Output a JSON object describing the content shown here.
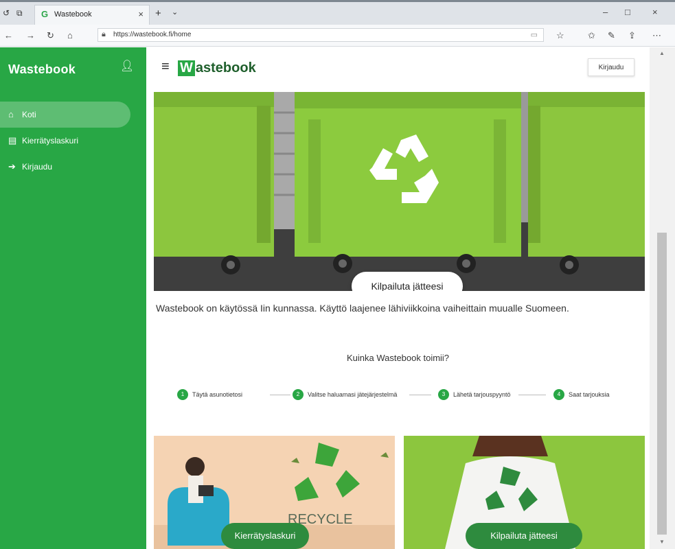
{
  "browser": {
    "tab_title": "Wastebook",
    "url": "https://wastebook.fi/home",
    "icons": [
      "back-icon",
      "forward-icon",
      "refresh-icon",
      "home-icon",
      "lock-icon",
      "reader-icon",
      "star-icon",
      "favorites-icon",
      "pen-icon",
      "share-icon",
      "more-icon"
    ]
  },
  "sidebar": {
    "logo": "Wastebook",
    "items": [
      {
        "label": "Koti",
        "icon": "home-icon"
      },
      {
        "label": "Kierrätyslaskuri",
        "icon": "calculator-icon"
      },
      {
        "label": "Kirjaudu",
        "icon": "login-icon"
      }
    ]
  },
  "header": {
    "logo_w": "W",
    "logo_rest": "astebook",
    "login_label": "Kirjaudu"
  },
  "hero": {
    "button_label": "Kilpailuta jätteesi"
  },
  "info_text": "Wastebook on käytössä Iin kunnassa. Käyttö laajenee lähiviikkoina vaiheittain muualle Suomeen.",
  "how": {
    "title": "Kuinka Wastebook toimii?",
    "steps": [
      {
        "num": "1",
        "label": "Täytä asunotietosi"
      },
      {
        "num": "2",
        "label": "Valitse haluamasi jätejärjestelmä"
      },
      {
        "num": "3",
        "label": "Lähetä tarjouspyyntö"
      },
      {
        "num": "4",
        "label": "Saat tarjouksia"
      }
    ]
  },
  "cards": [
    {
      "button_label": "Kierrätyslaskuri",
      "image_text": "RECYCLE"
    },
    {
      "button_label": "Kilpailuta jätteesi"
    }
  ],
  "colors": {
    "accent": "#28a745",
    "dark_green": "#2e8b3e"
  }
}
